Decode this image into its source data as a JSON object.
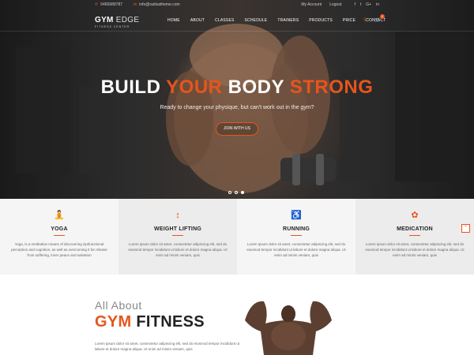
{
  "topbar": {
    "phone": "5465689787",
    "email": "info@radiustheme.com",
    "my_account": "My Account",
    "logout": "Logout",
    "social": [
      "f",
      "t",
      "G+",
      "in"
    ]
  },
  "logo": {
    "gym": "GYM",
    "edge": " EDGE",
    "sub": "FITNESS CENTER"
  },
  "menu": [
    "HOME",
    "ABOUT",
    "CLASSES",
    "SCHEDULE",
    "TRAINERS",
    "PRODUCTS",
    "PRICE",
    "CONTACT"
  ],
  "cart_count": "0",
  "hero": {
    "headline_1": "BUILD ",
    "headline_2": "YOUR",
    "headline_3": " BODY ",
    "headline_4": "STRONG",
    "subline": "Ready to change your physique, but can't work out in the gym?",
    "button": "JOIN WITH US"
  },
  "features": [
    {
      "icon": "yoga-icon",
      "title": "YOGA",
      "text": "Yoga, is a meditative means of discovering dysfunctional perception and cognition, as well as overcoming it for release from suffering, inner peace and salvation"
    },
    {
      "icon": "weight-lifting-icon",
      "title": "WEIGHT LIFTING",
      "text": "Lorem ipsum dolor sit amet, consectetur adipiscing elit, sed do eiusmod tempor incididunt ut labore et dolore magna aliqua. Ut enim ad minim veniam, quis"
    },
    {
      "icon": "running-icon",
      "title": "RUNNING",
      "text": "Lorem ipsum dolor sit amet, consectetur adipiscing elit, sed do eiusmod tempor incididunt ut labore et dolore magna aliqua. Ut enim ad minim veniam, quis"
    },
    {
      "icon": "medication-icon",
      "title": "MEDICATION",
      "text": "Lorem ipsum dolor sit amet, consectetur adipiscing elit, sed do eiusmod tempor incididunt ut labore et dolore magna aliqua. Ut enim ad minim veniam, quis"
    }
  ],
  "about": {
    "kicker": "All About",
    "title_1": "GYM",
    "title_2": " FITNESS",
    "para": "Lorem ipsum dolor sit amet, consectetur adipiscing elit, sed do eiusmod tempor incididunt ut labore et dolore magna aliqua. Ut enim ad minim veniam, quis"
  },
  "colors": {
    "accent": "#e8541c",
    "dark": "#222222",
    "feature_light": "#f5f5f5",
    "feature_grey": "#ececec"
  }
}
